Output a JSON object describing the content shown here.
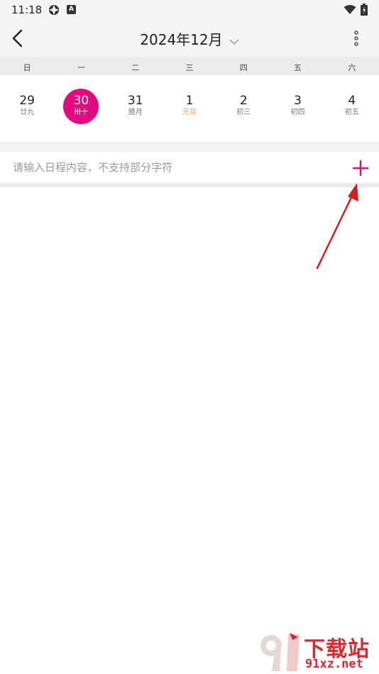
{
  "status": {
    "time": "11:18",
    "badge_letter": "A"
  },
  "app_bar": {
    "title": "2024年12月"
  },
  "week_days": [
    "日",
    "一",
    "二",
    "三",
    "四",
    "五",
    "六"
  ],
  "dates": [
    {
      "day": "29",
      "lunar": "廿九"
    },
    {
      "day": "30",
      "lunar": "卅十"
    },
    {
      "day": "31",
      "lunar": "腊月"
    },
    {
      "day": "1",
      "lunar": "元旦"
    },
    {
      "day": "2",
      "lunar": "初三"
    },
    {
      "day": "3",
      "lunar": "初四"
    },
    {
      "day": "4",
      "lunar": "初五"
    }
  ],
  "schedule": {
    "placeholder": "请输入日程内容，不支持部分字符",
    "value": ""
  },
  "watermark": {
    "title": "下载站",
    "url": "91xz.net"
  },
  "colors": {
    "accent": "#e5097f",
    "festival": "#e8a53a",
    "watermark": "#d8292f",
    "arrow": "#d71a1a"
  }
}
